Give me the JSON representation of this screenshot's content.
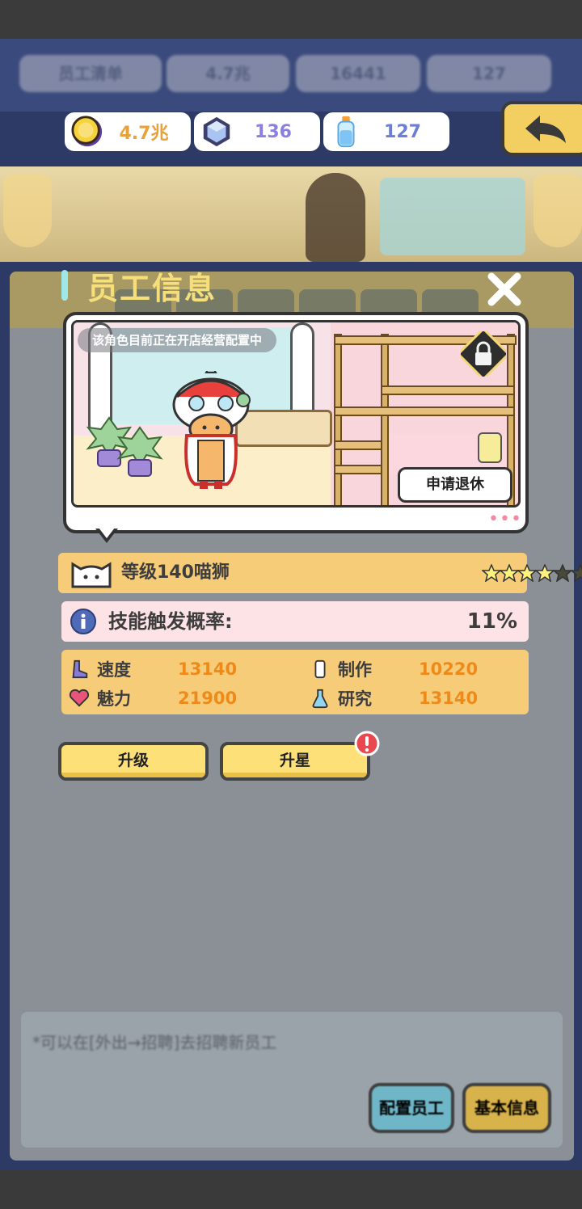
{
  "background_ui": {
    "top_chips": [
      "员工清单",
      "4.7兆",
      "16441",
      "127"
    ],
    "footer_hint": "*可以在[外出→招聘]去招聘新员工",
    "footer_buttons": [
      "配置员工",
      "基本信息"
    ]
  },
  "currency": {
    "gold": "4.7兆",
    "gems": "136",
    "potion": "127"
  },
  "dialog": {
    "title": "员工信息",
    "status_text": "该角色目前正在开店经营配置中",
    "retire_label": "申请退休",
    "more_dots": "•••",
    "level_text": "等级140喵狮",
    "stars": {
      "filled": 4,
      "total": 6
    },
    "skill_label": "技能触发概率:",
    "skill_value": "11%",
    "stats": {
      "speed_label": "速度",
      "speed_value": "13140",
      "make_label": "制作",
      "make_value": "10220",
      "charm_label": "魅力",
      "charm_value": "21900",
      "research_label": "研究",
      "research_value": "13140"
    },
    "upgrade_label": "升级",
    "star_up_label": "升星"
  },
  "colors": {
    "accent_yellow": "#f7cc79",
    "button_yellow": "#fde077",
    "value_orange": "#ee8a1a",
    "title_yellow": "#f6df7a",
    "gem_purple": "#8b7fe0",
    "potion_blue": "#6c7ed6"
  },
  "icons": [
    "coin-icon",
    "gem-icon",
    "potion-icon",
    "back-arrow-icon",
    "close-icon",
    "lock-icon",
    "cat-face-icon",
    "star-icon",
    "info-icon",
    "boot-icon",
    "heart-icon",
    "cup-icon",
    "flask-icon",
    "alert-icon"
  ]
}
